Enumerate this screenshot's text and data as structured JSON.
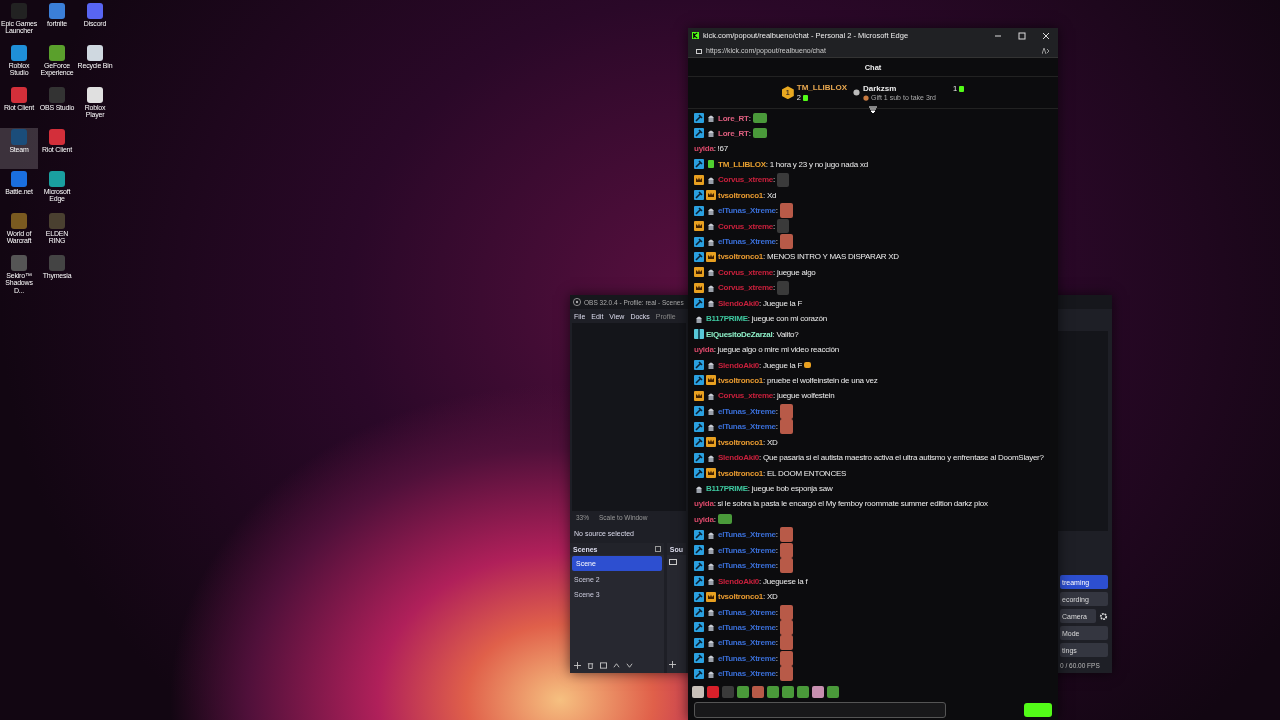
{
  "desktop_icons": [
    [
      {
        "label": "Epic Games Launcher",
        "selected": false
      },
      {
        "label": "fortnite",
        "selected": false
      },
      {
        "label": "Discord",
        "selected": false
      }
    ],
    [
      {
        "label": "Roblox Studio",
        "selected": false
      },
      {
        "label": "GeForce Experience",
        "selected": false
      },
      {
        "label": "Recycle Bin",
        "selected": false
      }
    ],
    [
      {
        "label": "Riot Client",
        "selected": false
      },
      {
        "label": "OBS Studio",
        "selected": false
      },
      {
        "label": "Roblox Player",
        "selected": false
      }
    ],
    [
      {
        "label": "Steam",
        "selected": true
      },
      {
        "label": "Riot Client",
        "selected": false
      }
    ],
    [
      {
        "label": "Battle.net",
        "selected": false
      },
      {
        "label": "Microsoft Edge",
        "selected": false
      }
    ],
    [
      {
        "label": "World of Warcraft",
        "selected": false
      },
      {
        "label": "ELDEN RING",
        "selected": false
      }
    ],
    [
      {
        "label": "Sekiro™ Shadows D...",
        "selected": false
      },
      {
        "label": "Thymesia",
        "selected": false
      }
    ]
  ],
  "obs": {
    "title": "OBS 32.0.4 - Profile: real - Scenes",
    "menu": [
      "File",
      "Edit",
      "View",
      "Docks",
      "Profile"
    ],
    "zoom": "33%",
    "scale_mode": "Scale to Window",
    "source_status": "No source selected",
    "scenes": {
      "title": "Scenes",
      "items": [
        {
          "label": "Scene",
          "selected": true
        },
        {
          "label": "Scene 2",
          "selected": false
        },
        {
          "label": "Scene 3",
          "selected": false
        }
      ]
    },
    "sources_title": "Sou",
    "controls": [
      {
        "label": "treaming",
        "selected": true
      },
      {
        "label": "ecording",
        "selected": false
      },
      {
        "label": "Camera",
        "selected": false
      },
      {
        "label": "Mode",
        "selected": false
      },
      {
        "label": "tings",
        "selected": false
      }
    ],
    "fps": "0 / 60.00 FPS"
  },
  "browser": {
    "title": "kick.com/popout/realbueno/chat - Personal 2 - Microsoft Edge",
    "url": "https://kick.com/popout/realbueno/chat"
  },
  "chat": {
    "title": "Chat",
    "leaderboard": [
      {
        "rank": "1",
        "user": "TM_LLIBLOX",
        "count": "2"
      },
      {
        "user": "Darkzsm",
        "count": "1",
        "note": "Gift 1 sub to take 3rd"
      }
    ],
    "messages": [
      {
        "badges": [
          {
            "kind": "mod"
          },
          {
            "kind": "sub"
          }
        ],
        "user": "Lore_RT",
        "color": "#e06080",
        "text": ":",
        "emote": {
          "kind": "frog"
        }
      },
      {
        "badges": [
          {
            "kind": "mod"
          },
          {
            "kind": "sub"
          }
        ],
        "user": "Lore_RT",
        "color": "#e06080",
        "text": ":",
        "emote": {
          "kind": "frog"
        }
      },
      {
        "user": "uyida",
        "color": "#d84868",
        "text": ": !67"
      },
      {
        "badges": [
          {
            "kind": "mod"
          },
          {
            "kind": "og"
          }
        ],
        "user": "TM_LLIBLOX",
        "color": "#e8a030",
        "text": ": 1 hora y 23 y no jugo nada xd"
      },
      {
        "badges": [
          {
            "kind": "vip"
          },
          {
            "kind": "sub"
          }
        ],
        "user": "Corvus_xtreme",
        "color": "#c8203c",
        "text": ":",
        "emote": {
          "kind": "dark"
        }
      },
      {
        "badges": [
          {
            "kind": "mod"
          },
          {
            "kind": "vip"
          }
        ],
        "user": "tvsoltronco1",
        "color": "#e89a30",
        "text": ": Xd"
      },
      {
        "badges": [
          {
            "kind": "mod"
          },
          {
            "kind": "sub"
          }
        ],
        "user": "elTunas_Xtreme",
        "color": "#3a6fd8",
        "text": ":",
        "emote": {
          "kind": "face"
        }
      },
      {
        "badges": [
          {
            "kind": "vip"
          },
          {
            "kind": "sub"
          }
        ],
        "user": "Corvus_xtreme",
        "color": "#c8203c",
        "text": ":",
        "emote": {
          "kind": "dark"
        }
      },
      {
        "badges": [
          {
            "kind": "mod"
          },
          {
            "kind": "sub"
          }
        ],
        "user": "elTunas_Xtreme",
        "color": "#3a6fd8",
        "text": ":",
        "emote": {
          "kind": "face"
        }
      },
      {
        "badges": [
          {
            "kind": "mod"
          },
          {
            "kind": "vip"
          }
        ],
        "user": "tvsoltronco1",
        "color": "#e89a30",
        "text": ": MENOS INTRO Y MAS DISPARAR XD"
      },
      {
        "badges": [
          {
            "kind": "vip"
          },
          {
            "kind": "sub"
          }
        ],
        "user": "Corvus_xtreme",
        "color": "#c8203c",
        "text": ": juegue algo"
      },
      {
        "badges": [
          {
            "kind": "vip"
          },
          {
            "kind": "sub"
          }
        ],
        "user": "Corvus_xtreme",
        "color": "#c8203c",
        "text": ":",
        "emote": {
          "kind": "dark"
        }
      },
      {
        "badges": [
          {
            "kind": "mod"
          },
          {
            "kind": "sub"
          }
        ],
        "user": "SlendoAki0",
        "color": "#c8203c",
        "text": ": Juegue la F"
      },
      {
        "badges": [
          {
            "kind": "sub"
          }
        ],
        "user": "B117PRIME",
        "color": "#3ec8a0",
        "text": ": juegue con mi corazón"
      },
      {
        "badges": [
          {
            "kind": "gift"
          }
        ],
        "user": "ElQuesitoDeZarzal",
        "color": "#8ef0c8",
        "text": ": Valito?"
      },
      {
        "user": "uyida",
        "color": "#d84868",
        "text": ": juegue algo o mire mi video reacción"
      },
      {
        "badges": [
          {
            "kind": "mod"
          },
          {
            "kind": "sub"
          }
        ],
        "user": "SlendoAki0",
        "color": "#c8203c",
        "text": ": Juegue la F",
        "emote": {
          "kind": "crown"
        }
      },
      {
        "badges": [
          {
            "kind": "mod"
          },
          {
            "kind": "vip"
          }
        ],
        "user": "tvsoltronco1",
        "color": "#e89a30",
        "text": ": pruebe el wolfeinstein de una vez"
      },
      {
        "badges": [
          {
            "kind": "vip"
          },
          {
            "kind": "sub"
          }
        ],
        "user": "Corvus_xtreme",
        "color": "#c8203c",
        "text": ": juegue wolfestein"
      },
      {
        "badges": [
          {
            "kind": "mod"
          },
          {
            "kind": "sub"
          }
        ],
        "user": "elTunas_Xtreme",
        "color": "#3a6fd8",
        "text": ":",
        "emote": {
          "kind": "face"
        }
      },
      {
        "badges": [
          {
            "kind": "mod"
          },
          {
            "kind": "sub"
          }
        ],
        "user": "elTunas_Xtreme",
        "color": "#3a6fd8",
        "text": ":",
        "emote": {
          "kind": "face"
        }
      },
      {
        "badges": [
          {
            "kind": "mod"
          },
          {
            "kind": "vip"
          }
        ],
        "user": "tvsoltronco1",
        "color": "#e89a30",
        "text": ": XD"
      },
      {
        "badges": [
          {
            "kind": "mod"
          },
          {
            "kind": "sub"
          }
        ],
        "user": "SlendoAki0",
        "color": "#c8203c",
        "text": ": Que pasaria si el autista maestro activa el ultra autismo y enfrentase al DoomSlayer?"
      },
      {
        "badges": [
          {
            "kind": "mod"
          },
          {
            "kind": "vip"
          }
        ],
        "user": "tvsoltronco1",
        "color": "#e89a30",
        "text": ": EL DOOM ENTONCES"
      },
      {
        "badges": [
          {
            "kind": "sub"
          }
        ],
        "user": "B117PRIME",
        "color": "#3ec8a0",
        "text": ": juegue bob esponja saw"
      },
      {
        "user": "uyida",
        "color": "#d84868",
        "text": ": si le sobra la pasta le encargó el My femboy roommate summer edition darkz plox"
      },
      {
        "user": "uyida",
        "color": "#d84868",
        "text": ":",
        "emote": {
          "kind": "frog"
        }
      },
      {
        "badges": [
          {
            "kind": "mod"
          },
          {
            "kind": "sub"
          }
        ],
        "user": "elTunas_Xtreme",
        "color": "#3a6fd8",
        "text": ":",
        "emote": {
          "kind": "face"
        }
      },
      {
        "badges": [
          {
            "kind": "mod"
          },
          {
            "kind": "sub"
          }
        ],
        "user": "elTunas_Xtreme",
        "color": "#3a6fd8",
        "text": ":",
        "emote": {
          "kind": "face"
        }
      },
      {
        "badges": [
          {
            "kind": "mod"
          },
          {
            "kind": "sub"
          }
        ],
        "user": "elTunas_Xtreme",
        "color": "#3a6fd8",
        "text": ":",
        "emote": {
          "kind": "face"
        }
      },
      {
        "badges": [
          {
            "kind": "mod"
          },
          {
            "kind": "sub"
          }
        ],
        "user": "SlendoAki0",
        "color": "#c8203c",
        "text": ": Jueguese la f"
      },
      {
        "badges": [
          {
            "kind": "mod"
          },
          {
            "kind": "vip"
          }
        ],
        "user": "tvsoltronco1",
        "color": "#e89a30",
        "text": ": XD"
      },
      {
        "badges": [
          {
            "kind": "mod"
          },
          {
            "kind": "sub"
          }
        ],
        "user": "elTunas_Xtreme",
        "color": "#3a6fd8",
        "text": ":",
        "emote": {
          "kind": "face"
        }
      },
      {
        "badges": [
          {
            "kind": "mod"
          },
          {
            "kind": "sub"
          }
        ],
        "user": "elTunas_Xtreme",
        "color": "#3a6fd8",
        "text": ":",
        "emote": {
          "kind": "face"
        }
      },
      {
        "badges": [
          {
            "kind": "mod"
          },
          {
            "kind": "sub"
          }
        ],
        "user": "elTunas_Xtreme",
        "color": "#3a6fd8",
        "text": ":",
        "emote": {
          "kind": "face"
        }
      },
      {
        "badges": [
          {
            "kind": "mod"
          },
          {
            "kind": "sub"
          }
        ],
        "user": "elTunas_Xtreme",
        "color": "#3a6fd8",
        "text": ":",
        "emote": {
          "kind": "face"
        }
      },
      {
        "badges": [
          {
            "kind": "mod"
          },
          {
            "kind": "sub"
          }
        ],
        "user": "elTunas_Xtreme",
        "color": "#3a6fd8",
        "text": ":",
        "emote": {
          "kind": "face"
        }
      }
    ],
    "emote_bar": [
      {
        "kind": "cat"
      },
      {
        "kind": "red"
      },
      {
        "kind": "dark"
      },
      {
        "kind": "frog"
      },
      {
        "kind": "face"
      },
      {
        "kind": "frog"
      },
      {
        "kind": "frog"
      },
      {
        "kind": "frog"
      },
      {
        "kind": "pink"
      },
      {
        "kind": "frog"
      }
    ]
  }
}
